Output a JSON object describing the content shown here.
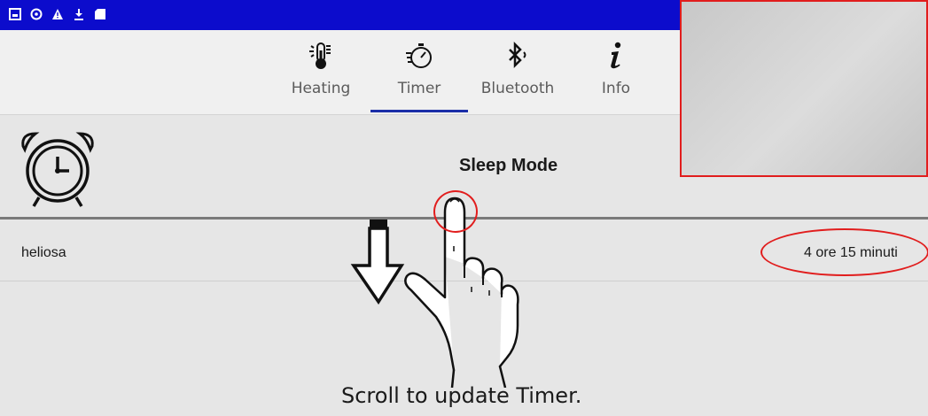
{
  "status_bar": {
    "color": "#0c0ccc",
    "icons": [
      "image-icon",
      "sync-icon",
      "warning-icon",
      "download-icon",
      "sd-card-icon"
    ]
  },
  "tabs": [
    {
      "label": "Heating",
      "icon": "thermometer-icon"
    },
    {
      "label": "Timer",
      "icon": "stopwatch-icon",
      "selected": true
    },
    {
      "label": "Bluetooth",
      "icon": "bluetooth-icon"
    },
    {
      "label": "Info",
      "icon": "info-icon"
    }
  ],
  "header": {
    "title": "Sleep Mode",
    "icon": "alarm-clock-icon"
  },
  "row": {
    "label": "heliosa",
    "value": "4 ore 15 minuti"
  },
  "annotation": {
    "hint": "Scroll to update Timer.",
    "highlight_color": "#e11d1d"
  },
  "colors": {
    "accent": "#1b2ea8",
    "tab_bg": "#f0f0f0",
    "content_bg": "#e6e6e6"
  }
}
